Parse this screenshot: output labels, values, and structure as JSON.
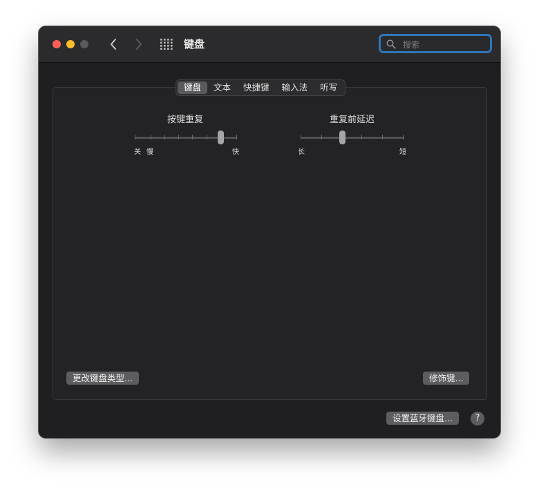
{
  "window": {
    "title": "键盘"
  },
  "search": {
    "placeholder": "搜索",
    "value": ""
  },
  "tabs": [
    {
      "label": "键盘",
      "active": true
    },
    {
      "label": "文本",
      "active": false
    },
    {
      "label": "快捷键",
      "active": false
    },
    {
      "label": "输入法",
      "active": false
    },
    {
      "label": "听写",
      "active": false
    }
  ],
  "key_repeat": {
    "label": "按键重复",
    "left_label_1": "关",
    "left_label_2": "慢",
    "right_label": "快",
    "level": 0.83
  },
  "delay_until_repeat": {
    "label": "重复前延迟",
    "left_label": "长",
    "right_label": "短",
    "level": 0.4
  },
  "buttons": {
    "change_keyboard_type": "更改键盘类型...",
    "modifier_keys": "修饰键...",
    "setup_bluetooth_keyboard": "设置蓝牙键盘...",
    "help": "?"
  },
  "colors": {
    "close": "#ff5f57",
    "minimize": "#febc2e",
    "search_focus": "#2f76b8"
  }
}
